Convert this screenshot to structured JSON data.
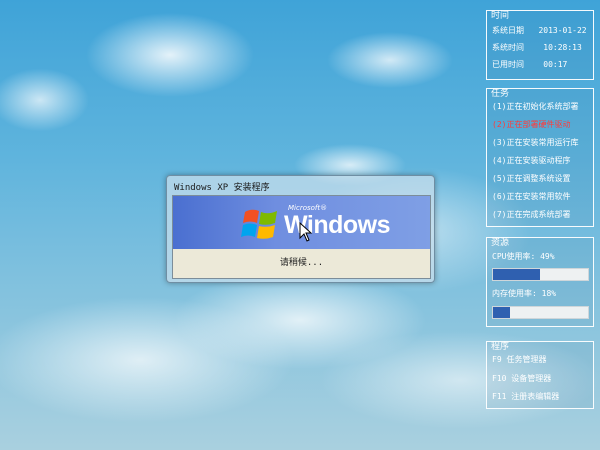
{
  "setup_window": {
    "title": "Windows XP 安装程序",
    "brand_small": "Microsoft®",
    "brand_main": "Windows",
    "status_text": "请稍候..."
  },
  "time_panel": {
    "header": "时间",
    "date_label": "系统日期",
    "date_value": "2013-01-22",
    "time_label": "系统时间",
    "time_value": "10:28:13",
    "elapsed_label": "已用时间",
    "elapsed_value": "00:17"
  },
  "task_panel": {
    "header": "任务",
    "items": [
      "(1)正在初始化系统部署",
      "(2)正在部署硬件驱动",
      "(3)正在安装常用运行库",
      "(4)正在安装驱动程序",
      "(5)正在调整系统设置",
      "(6)正在安装常用软件",
      "(7)正在完成系统部署"
    ],
    "active_index": 1,
    "active_color": "#ff3b3b"
  },
  "resource_panel": {
    "header": "资源",
    "cpu_label": "CPU使用率: 49%",
    "cpu_percent": 49,
    "mem_label": "内存使用率: 18%",
    "mem_percent": 18,
    "bar_color": "#2f60b0"
  },
  "program_panel": {
    "header": "程序",
    "items": [
      "F9  任务管理器",
      "F10 设备管理器",
      "F11 注册表编辑器"
    ]
  }
}
